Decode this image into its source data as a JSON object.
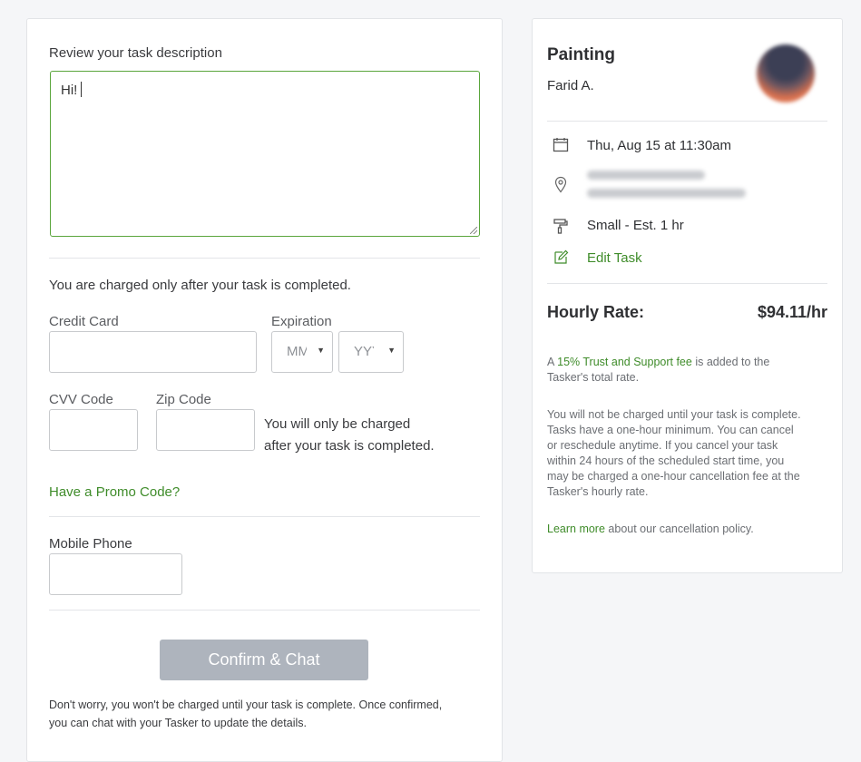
{
  "form": {
    "description_label": "Review your task description",
    "description_value": "Hi!",
    "charge_note": "You are charged only after your task is completed.",
    "credit_card_label": "Credit Card",
    "expiration_label": "Expiration",
    "month_placeholder": "MM",
    "year_placeholder": "YYYY",
    "cvv_label": "CVV Code",
    "zip_label": "Zip Code",
    "side_note_line1": "You will only be charged",
    "side_note_line2": "after your task is completed.",
    "promo_link": "Have a Promo Code?",
    "phone_label": "Mobile Phone",
    "confirm_button": "Confirm & Chat",
    "footer_line1": "Don't worry, you won't be charged until your task is complete. Once confirmed,",
    "footer_line2": "you can chat with your Tasker to update the details."
  },
  "summary": {
    "title": "Painting",
    "tasker_name": "Farid A.",
    "date": "Thu, Aug 15 at 11:30am",
    "size": "Small - Est. 1 hr",
    "edit_link": "Edit Task",
    "rate_label": "Hourly Rate:",
    "rate_value": "$94.11/hr",
    "fee_prefix": "A ",
    "fee_link": "15% Trust and Support fee",
    "fee_suffix": " is added to the",
    "fee_line2": "Tasker's total rate.",
    "policy_lines": [
      "You will not be charged until your task is complete.",
      "Tasks have a one-hour minimum. You can cancel",
      "or reschedule anytime. If you cancel your task",
      "within 24 hours of the scheduled start time, you",
      "may be charged a one-hour cancellation fee at the",
      "Tasker's hourly rate."
    ],
    "learn_more_link": "Learn more",
    "learn_more_suffix": " about our cancellation policy."
  },
  "icons": {
    "calendar": "calendar-icon",
    "location": "location-pin-icon",
    "size": "paint-roller-icon",
    "edit": "pencil-icon"
  },
  "colors": {
    "accent_green": "#3f8c2a",
    "button_disabled": "#aeb4bd",
    "focus_border": "#5aa63c"
  }
}
